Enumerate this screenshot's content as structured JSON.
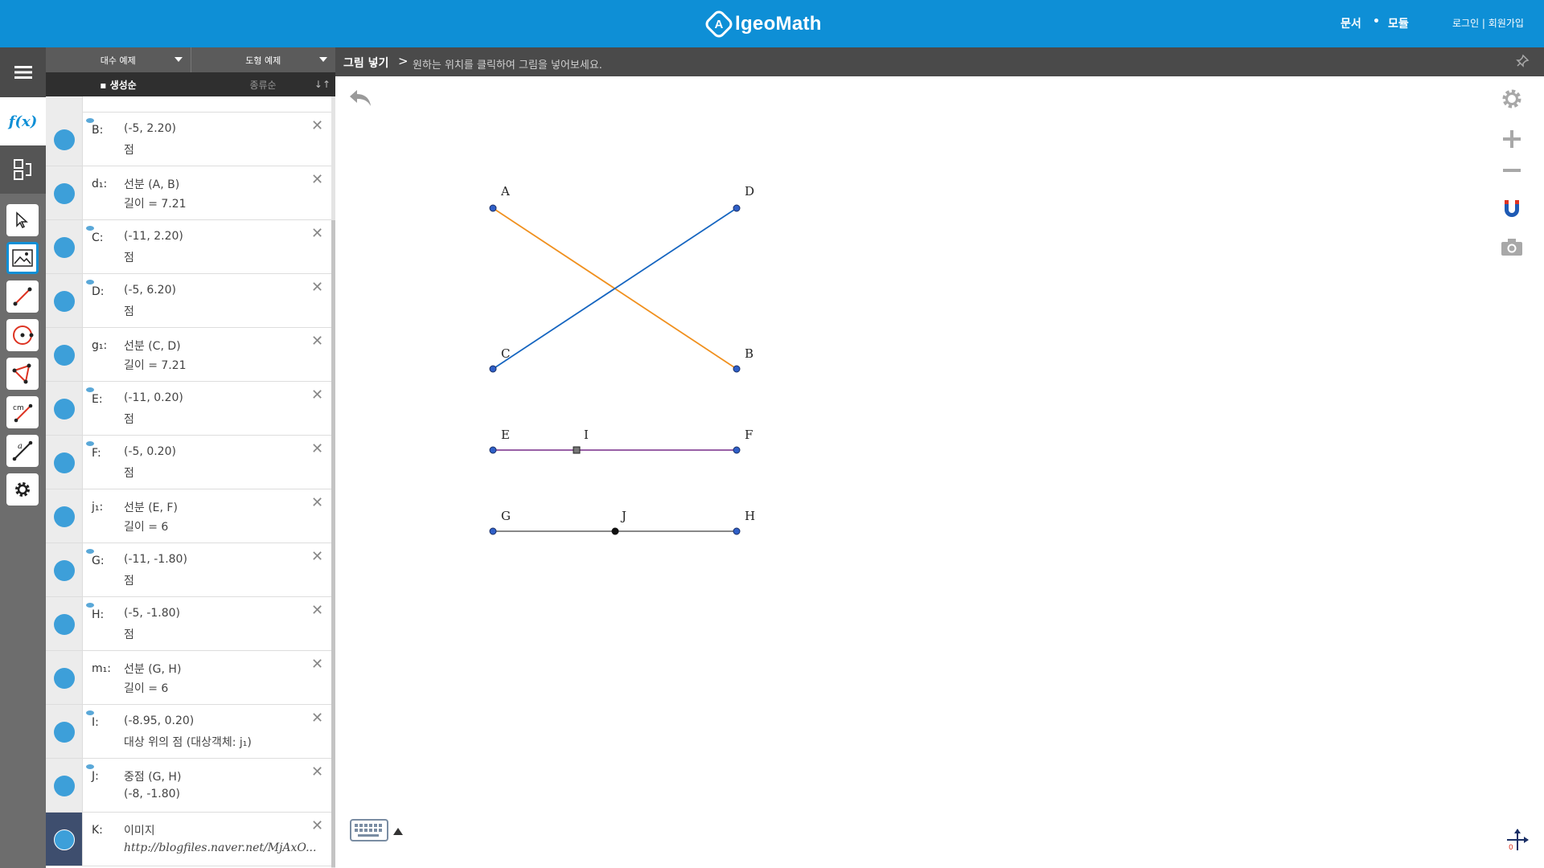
{
  "header": {
    "logo_mark": "A",
    "logo_text": "lgeoMath",
    "nav": {
      "documents": "문서",
      "separator": "•",
      "modules": "모듈"
    },
    "auth": "로그인 | 회원가입"
  },
  "panel": {
    "dropdowns": {
      "algebra": "대수 예제",
      "geometry": "도형 예제"
    },
    "sort": {
      "creation": "▪ 생성순",
      "type": "종류순",
      "toggle_icon": "↓↑"
    },
    "objects": [
      {
        "name": "B:",
        "line1": "(-5, 2.20)",
        "line2": "점"
      },
      {
        "name": "d₁:",
        "line1": "선분 (A, B)",
        "line2": "길이 = 7.21"
      },
      {
        "name": "C:",
        "line1": "(-11, 2.20)",
        "line2": "점"
      },
      {
        "name": "D:",
        "line1": "(-5, 6.20)",
        "line2": "점"
      },
      {
        "name": "g₁:",
        "line1": "선분 (C, D)",
        "line2": "길이 = 7.21"
      },
      {
        "name": "E:",
        "line1": "(-11, 0.20)",
        "line2": "점"
      },
      {
        "name": "F:",
        "line1": "(-5, 0.20)",
        "line2": "점"
      },
      {
        "name": "j₁:",
        "line1": "선분 (E, F)",
        "line2": "길이 = 6"
      },
      {
        "name": "G:",
        "line1": "(-11, -1.80)",
        "line2": "점"
      },
      {
        "name": "H:",
        "line1": "(-5, -1.80)",
        "line2": "점"
      },
      {
        "name": "m₁:",
        "line1": "선분 (G, H)",
        "line2": "길이 = 6"
      },
      {
        "name": "I:",
        "line1": "(-8.95, 0.20)",
        "line2": "대상 위의 점 (대상객체: j₁)"
      },
      {
        "name": "J:",
        "line1": "중점 (G, H)",
        "line2": "(-8, -1.80)"
      },
      {
        "name": "K:",
        "line1": "이미지",
        "line2": "http://blogfiles.naver.net/MjAxO..."
      }
    ]
  },
  "toolbar": {
    "title": "그림 넣기",
    "arrow": ">",
    "hint": "원하는 위치를 클릭하여 그림을 넣어보세요."
  },
  "canvas": {
    "points": {
      "A": "A",
      "B": "B",
      "C": "C",
      "D": "D",
      "E": "E",
      "F": "F",
      "G": "G",
      "H": "H",
      "I": "I",
      "J": "J"
    },
    "colors": {
      "AB": "#f0901e",
      "CD": "#1565c0",
      "EF": "#8a4a9a",
      "GH": "#777777",
      "point": "#2f5fc7"
    }
  },
  "icons": {
    "left": [
      "menu-icon",
      "fx-icon",
      "swap-view-icon",
      "select-icon",
      "insert-image-icon",
      "segment-icon",
      "circle-icon",
      "polygon-icon",
      "measure-icon",
      "angle-tool-icon",
      "settings-icon"
    ],
    "right": [
      "gear-icon",
      "zoom-in-icon",
      "zoom-out-icon",
      "magnet-icon",
      "camera-icon"
    ]
  },
  "left_tool_labels": {
    "fx": "f(x)",
    "measure": "cm",
    "angle": "a"
  },
  "compass_label": "0"
}
